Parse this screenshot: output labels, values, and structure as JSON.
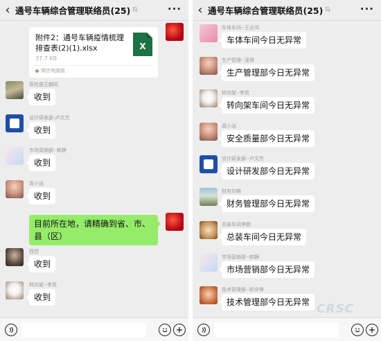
{
  "left": {
    "header": {
      "back": "‹",
      "title": "通号车辆综合管理联络员(25)",
      "more": "···"
    },
    "file": {
      "name": "附件2：通号车辆疫情梳理排查表(2)(1).xlsx",
      "size": "37.7 KB",
      "source": "微信电脑版"
    },
    "messages": [
      {
        "sender": "质检部王麟鸣",
        "text": "收到"
      },
      {
        "sender": "设计研发部-卢文杰",
        "text": "收到"
      },
      {
        "sender": "市场营销部--韩静",
        "text": "收到"
      },
      {
        "sender": "周小洁",
        "text": "收到"
      },
      {
        "sender": "",
        "text": "目前所在地，请精确到省、市、县（区）"
      },
      {
        "sender": "西西",
        "text": "收到"
      },
      {
        "sender": "转向架--李岚",
        "text": "收到"
      }
    ]
  },
  "right": {
    "header": {
      "back": "‹",
      "title": "通号车辆综合管理联络员(25)",
      "more": "···"
    },
    "messages": [
      {
        "sender": "车体车间--王业鸿",
        "text": "车体车间今日无异常"
      },
      {
        "sender": "生产管理--凌哥",
        "text": "生产管理部今日无异常"
      },
      {
        "sender": "转向架--李岚",
        "text": "转向架车间今日无异常"
      },
      {
        "sender": "周小洁",
        "text": "安全质量部今日无异常"
      },
      {
        "sender": "设计研发部--卢文杰",
        "text": "设计研发部今日无异常"
      },
      {
        "sender": "财务刘艳",
        "text": "财务管理部今日无异常"
      },
      {
        "sender": "总装车间李鹏",
        "text": "总装车间今日无异常"
      },
      {
        "sender": "市场营销部--韩静",
        "text": "市场营销部今日无异常"
      },
      {
        "sender": "技术管理部--段安锋",
        "text": "技术管理部今日无异常"
      }
    ]
  },
  "watermark": "CRSC",
  "icons": {
    "back": "chevron-left-icon",
    "mute": "bell-off-icon",
    "more": "more-dots-icon",
    "voice": "voice-icon",
    "emoji": "emoji-icon",
    "plus": "plus-icon",
    "file": "excel-icon"
  },
  "colors": {
    "sent_bubble": "#95ec69",
    "chat_bg": "#ededed",
    "excel_green": "#1e7145"
  }
}
